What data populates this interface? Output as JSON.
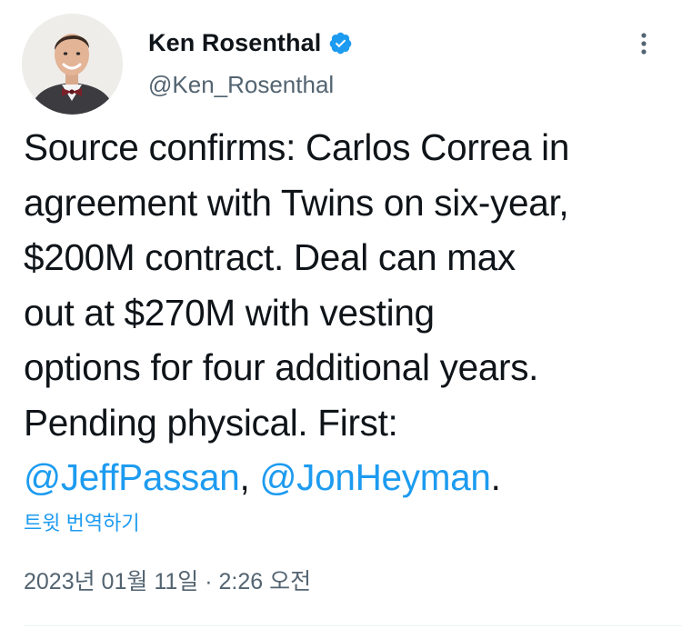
{
  "author": {
    "display_name": "Ken Rosenthal",
    "handle": "@Ken_Rosenthal",
    "verified": true,
    "verified_color": "#1d9bf0",
    "avatar_icon": "profile-photo"
  },
  "more_icon": "vertical-ellipsis-icon",
  "tweet": {
    "lines": [
      "Source confirms: Carlos Correa in",
      "agreement with Twins on six-year,",
      "$200M contract. Deal can max",
      "out at $270M with vesting",
      "options for four additional years.",
      "Pending physical. First:"
    ],
    "mention_1": "@JeffPassan",
    "separator": ", ",
    "mention_2": "@JonHeyman",
    "ending": "."
  },
  "translate_label": "트윗 번역하기",
  "timestamp": "2023년 01월 11일 · 2:26 오전",
  "colors": {
    "link": "#1d9bf0",
    "text": "#0f1419",
    "secondary": "#536471"
  }
}
